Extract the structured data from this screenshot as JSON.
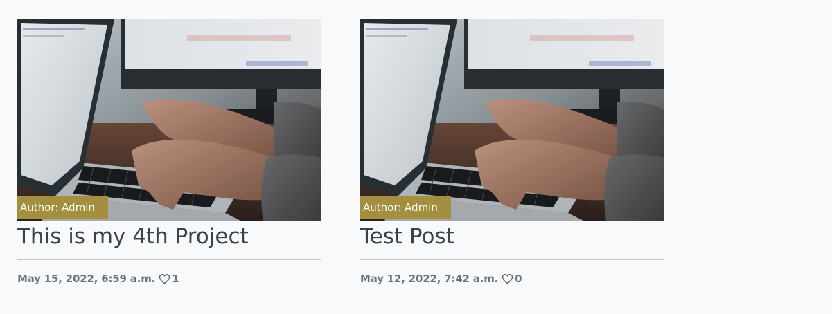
{
  "posts": [
    {
      "author_label": "Author: Admin",
      "title": "This is my 4th Project",
      "date": "May 15, 2022, 6:59 a.m.",
      "likes": "1",
      "thumbnail": "laptop typing photo"
    },
    {
      "author_label": "Author: Admin",
      "title": "Test Post",
      "date": "May 12, 2022, 7:42 a.m.",
      "likes": "0",
      "thumbnail": "laptop typing photo"
    }
  ],
  "colors": {
    "background": "#f8f9fa",
    "author_badge": "#a38f3d",
    "title": "#3b4148",
    "meta": "#6c757d"
  },
  "icons": {
    "like": "heart-icon"
  }
}
